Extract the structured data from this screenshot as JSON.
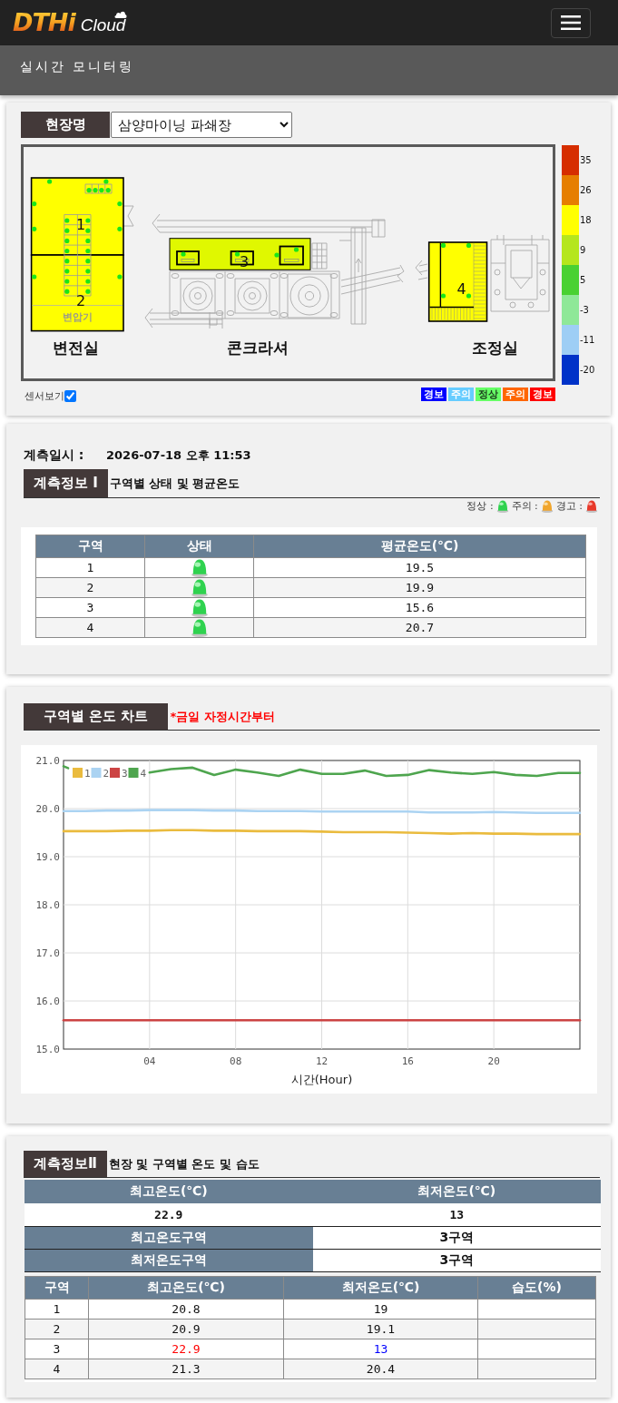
{
  "navbar": {
    "logo": "DTHi",
    "logo_sub": "Cloud"
  },
  "page_title": "실시간 모니터링",
  "site_panel": {
    "label": "현장명",
    "site": "삼양마이닝 파쇄장",
    "diagram": {
      "zones": [
        {
          "label": "1",
          "color": "#ffff00"
        },
        {
          "label": "2",
          "color": "#ffff00"
        },
        {
          "label": "3",
          "color": "#e0f800"
        },
        {
          "label": "4",
          "color": "#ffff00"
        }
      ],
      "rooms": [
        {
          "label": "변전실"
        },
        {
          "label": "콘크라셔"
        },
        {
          "label": "조정실"
        }
      ],
      "equipment_label": "변압기"
    },
    "color_scale": [
      {
        "label": "35",
        "color": "#d62e00"
      },
      {
        "label": "26",
        "color": "#e67e00"
      },
      {
        "label": "18",
        "color": "#ffff00"
      },
      {
        "label": "9",
        "color": "#b5e61d"
      },
      {
        "label": "5",
        "color": "#49d132"
      },
      {
        "label": "-3",
        "color": "#8fe898"
      },
      {
        "label": "-11",
        "color": "#9ecef5"
      },
      {
        "label": "-20",
        "color": "#0032c8"
      }
    ],
    "sensor_toggle": {
      "label": "센서보기",
      "checked": true
    },
    "status_legend": [
      {
        "label": "경보",
        "color": "#0000ff"
      },
      {
        "label": "주의",
        "color": "#66ccff"
      },
      {
        "label": "정상",
        "color": "#66ff66"
      },
      {
        "label": "주의",
        "color": "#ff6600"
      },
      {
        "label": "경보",
        "color": "#ff0000"
      }
    ]
  },
  "measurement": {
    "time_label": "계측일시 :",
    "time": "2026-07-18 오후 11:53",
    "section": {
      "title": "계측정보 Ⅰ",
      "subtitle": "구역별 상태 및 평균온도"
    },
    "status_key": [
      {
        "label": "정상 :",
        "kind": "normal"
      },
      {
        "label": "주의 :",
        "kind": "caution"
      },
      {
        "label": "경고 :",
        "kind": "warning"
      }
    ],
    "table": {
      "columns": [
        "구역",
        "상태",
        "평균온도(℃)"
      ],
      "rows": [
        {
          "zone": "1",
          "kind": "normal",
          "average": "19.5"
        },
        {
          "zone": "2",
          "kind": "normal",
          "average": "19.9"
        },
        {
          "zone": "3",
          "kind": "normal",
          "average": "15.6"
        },
        {
          "zone": "4",
          "kind": "normal",
          "average": "20.7"
        }
      ]
    }
  },
  "temperature_chart": {
    "title": "구역별 온도 차트",
    "note": "*금일 자정시간부터",
    "chart_data": {
      "type": "line",
      "xlabel": "시간(Hour)",
      "x": [
        0,
        1,
        2,
        3,
        4,
        5,
        6,
        7,
        8,
        9,
        10,
        11,
        12,
        13,
        14,
        15,
        16,
        17,
        18,
        19,
        20,
        21,
        22,
        23,
        24
      ],
      "series": [
        {
          "name": "1",
          "color": "#eabb3e",
          "values": [
            19.53,
            19.53,
            19.53,
            19.54,
            19.54,
            19.55,
            19.55,
            19.54,
            19.54,
            19.53,
            19.53,
            19.53,
            19.52,
            19.51,
            19.51,
            19.51,
            19.5,
            19.49,
            19.48,
            19.49,
            19.48,
            19.48,
            19.47,
            19.47,
            19.47
          ]
        },
        {
          "name": "2",
          "color": "#abd3f2",
          "values": [
            19.95,
            19.95,
            19.96,
            19.96,
            19.97,
            19.97,
            19.97,
            19.96,
            19.96,
            19.95,
            19.95,
            19.95,
            19.94,
            19.94,
            19.94,
            19.94,
            19.94,
            19.92,
            19.92,
            19.92,
            19.93,
            19.92,
            19.91,
            19.91,
            19.91
          ]
        },
        {
          "name": "3",
          "color": "#cc4444",
          "values": [
            15.6,
            15.6,
            15.6,
            15.6,
            15.6,
            15.6,
            15.6,
            15.6,
            15.6,
            15.6,
            15.6,
            15.6,
            15.6,
            15.6,
            15.6,
            15.6,
            15.6,
            15.6,
            15.6,
            15.6,
            15.6,
            15.6,
            15.6,
            15.6,
            15.6
          ]
        },
        {
          "name": "4",
          "color": "#4ea54e",
          "values": [
            20.88,
            null,
            null,
            null,
            20.75,
            20.82,
            20.85,
            20.7,
            20.81,
            20.75,
            20.68,
            20.81,
            20.72,
            20.72,
            20.79,
            20.68,
            20.7,
            20.8,
            20.75,
            20.72,
            20.76,
            20.7,
            20.68,
            20.74,
            20.74
          ]
        }
      ],
      "xlim": [
        0,
        24
      ],
      "ylim": [
        15,
        21
      ],
      "xticks": [
        {
          "value": 4,
          "label": "04"
        },
        {
          "value": 8,
          "label": "08"
        },
        {
          "value": 12,
          "label": "12"
        },
        {
          "value": 16,
          "label": "16"
        },
        {
          "value": 20,
          "label": "20"
        }
      ],
      "yticks": [
        {
          "value": 15,
          "label": "15.0"
        },
        {
          "value": 16,
          "label": "16.0"
        },
        {
          "value": 17,
          "label": "17.0"
        },
        {
          "value": 18,
          "label": "18.0"
        },
        {
          "value": 19,
          "label": "19.0"
        },
        {
          "value": 20,
          "label": "20.0"
        },
        {
          "value": 21,
          "label": "21.0"
        }
      ],
      "grid": true,
      "legend": "upper left"
    }
  },
  "summary": {
    "section": {
      "title": "계측정보Ⅱ",
      "subtitle": "현장 및 구역별 온도 및 습도"
    },
    "overall": {
      "columns": [
        "최고온도(℃)",
        "최저온도(℃)"
      ],
      "values": [
        "22.9",
        "13"
      ],
      "zones": [
        {
          "label": "최고온도구역",
          "value": "3구역"
        },
        {
          "label": "최저온도구역",
          "value": "3구역"
        }
      ]
    },
    "table": {
      "columns": [
        "구역",
        "최고온도(℃)",
        "최저온도(℃)",
        "습도(%)"
      ],
      "rows": [
        {
          "zone": "1",
          "max": "20.8",
          "min": "19",
          "max_highlight": false,
          "min_highlight": false
        },
        {
          "zone": "2",
          "max": "20.9",
          "min": "19.1",
          "max_highlight": false,
          "min_highlight": false
        },
        {
          "zone": "3",
          "max": "22.9",
          "min": "13",
          "max_highlight": true,
          "min_highlight": true
        },
        {
          "zone": "4",
          "max": "21.3",
          "min": "20.4",
          "max_highlight": false,
          "min_highlight": false
        }
      ]
    }
  }
}
